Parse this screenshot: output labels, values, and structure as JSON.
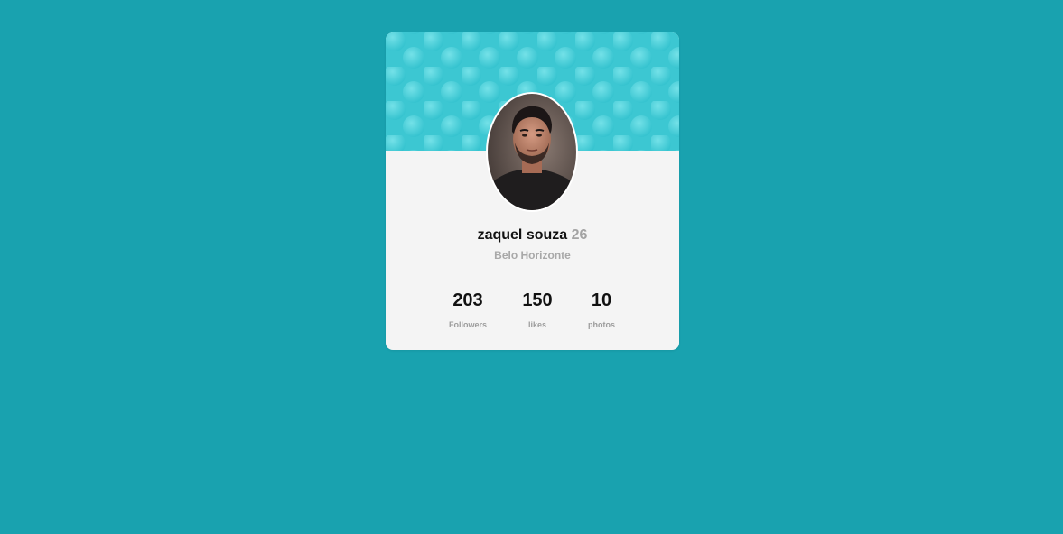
{
  "profile": {
    "name": "zaquel souza",
    "age": "26",
    "location": "Belo Horizonte"
  },
  "stats": [
    {
      "value": "203",
      "label": "Followers"
    },
    {
      "value": "150",
      "label": "likes"
    },
    {
      "value": "10",
      "label": "photos"
    }
  ],
  "colors": {
    "background": "#19a2af",
    "card": "#f4f4f4",
    "cover": "#3fc9d4",
    "name": "#111111",
    "muted": "#a8a8a8"
  }
}
